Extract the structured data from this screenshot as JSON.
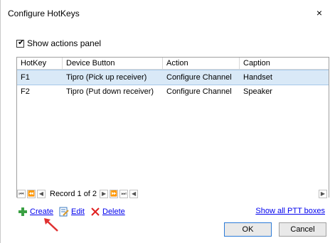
{
  "window": {
    "title": "Configure HotKeys",
    "close_glyph": "×"
  },
  "checkbox": {
    "label": "Show actions panel",
    "checked": true
  },
  "grid": {
    "columns": [
      "HotKey",
      "Device Button",
      "Action",
      "Caption"
    ],
    "rows": [
      {
        "hotkey": "F1",
        "device_button": "Tipro (Pick up receiver)",
        "action": "Configure Channel",
        "caption": "Handset",
        "selected": true
      },
      {
        "hotkey": "F2",
        "device_button": "Tipro (Put down receiver)",
        "action": "Configure Channel",
        "caption": "Speaker",
        "selected": false
      }
    ]
  },
  "pager": {
    "record_text": "Record 1 of 2",
    "buttons": [
      "⏮",
      "⏪",
      "◀",
      "▶",
      "⏩",
      "⏭",
      "◀"
    ]
  },
  "actions": {
    "create_label": "Create",
    "edit_label": "Edit",
    "delete_label": "Delete",
    "show_ptt_label": "Show all PTT boxes"
  },
  "buttons": {
    "ok_label": "OK",
    "cancel_label": "Cancel"
  },
  "colors": {
    "selection": "#d9e9f7",
    "link": "#0000ee",
    "create_icon": "#3aa043",
    "delete_icon": "#e02020",
    "arrow": "#e03030"
  }
}
